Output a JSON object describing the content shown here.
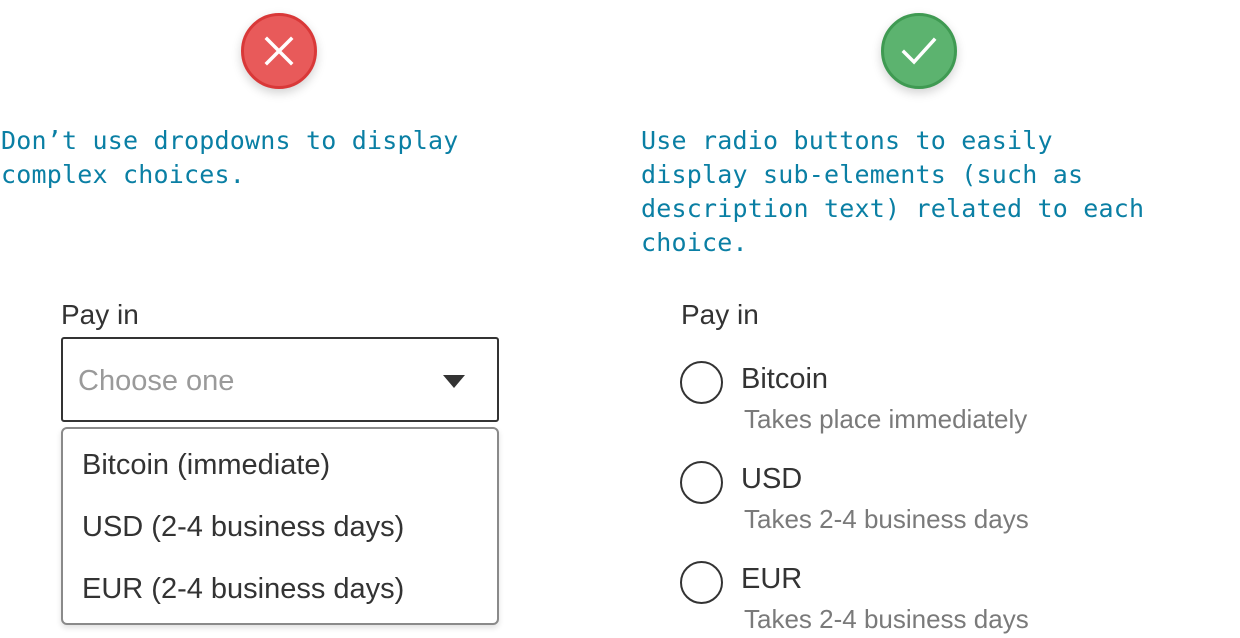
{
  "dont": {
    "icon": "x-icon",
    "color": "#e85a5a",
    "caption": "Don’t use dropdowns to display\ncomplex choices.",
    "field_label": "Pay in",
    "placeholder": "Choose one",
    "options": [
      "Bitcoin (immediate)",
      "USD (2-4 business days)",
      "EUR (2-4 business days)"
    ]
  },
  "do": {
    "icon": "checkmark-icon",
    "color": "#5cb36f",
    "caption": "Use radio buttons to easily\ndisplay sub-elements (such as\ndescription text) related to each\nchoice.",
    "field_label": "Pay in",
    "options": [
      {
        "label": "Bitcoin",
        "description": "Takes place immediately"
      },
      {
        "label": "USD",
        "description": "Takes 2-4 business days"
      },
      {
        "label": "EUR",
        "description": "Takes 2-4 business days"
      }
    ]
  },
  "accent_color": "#0a7fa4"
}
